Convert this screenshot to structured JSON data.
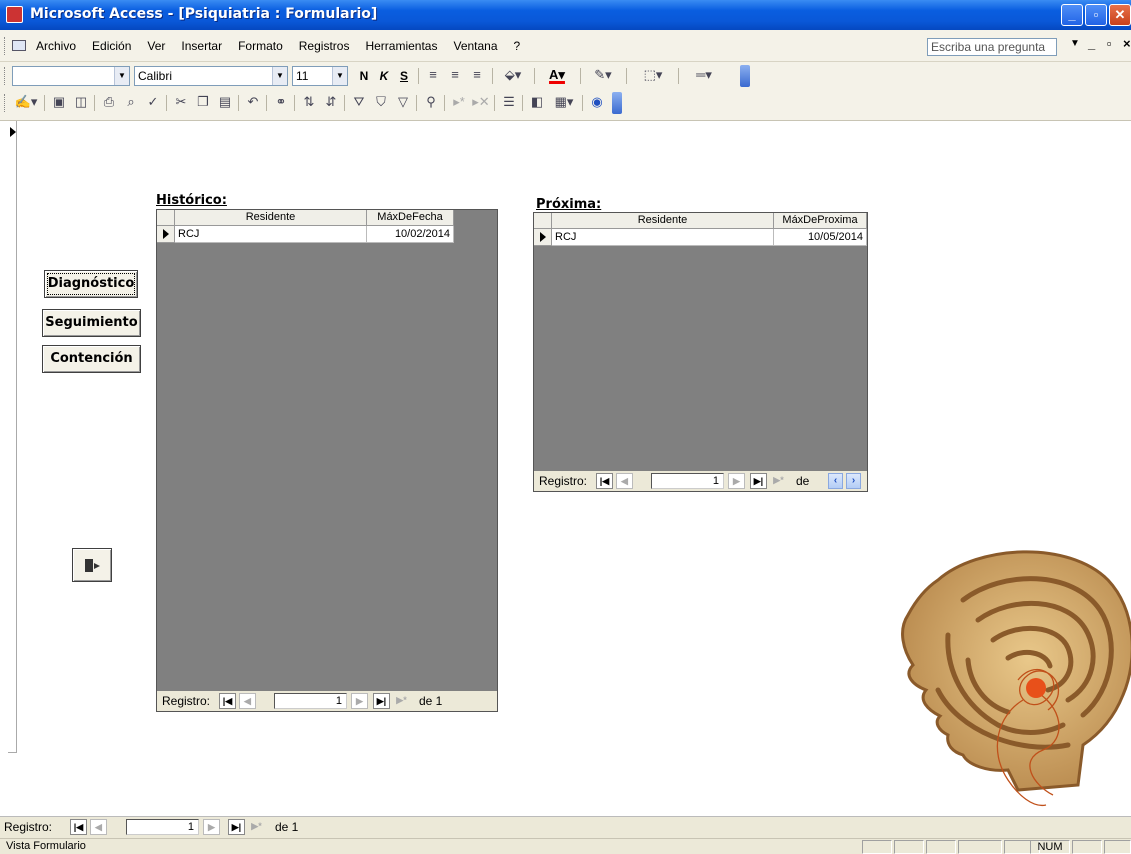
{
  "window": {
    "title": "Microsoft Access - [Psiquiatria : Formulario]",
    "controls": {
      "minimize": "_",
      "maximize": "▫",
      "close": "✕"
    }
  },
  "menubar": {
    "items": [
      "Archivo",
      "Edición",
      "Ver",
      "Insertar",
      "Formato",
      "Registros",
      "Herramientas",
      "Ventana",
      "?"
    ],
    "ask_placeholder": "Escriba una pregunta",
    "mdi_controls": "_ ▫ ×"
  },
  "format_toolbar": {
    "object_combo": "",
    "font_name": "Calibri",
    "font_size": "11",
    "bold": "N",
    "italic": "K",
    "underline": "S"
  },
  "form": {
    "buttons": [
      "Diagnóstico",
      "Seguimiento",
      "Contención"
    ],
    "historico": {
      "label": "Histórico:",
      "columns": [
        "Residente",
        "MáxDeFecha"
      ],
      "rows": [
        [
          "RCJ",
          "10/02/2014"
        ]
      ],
      "nav": {
        "label": "Registro:",
        "current": "1",
        "of_text": "de 1"
      }
    },
    "proxima": {
      "label": "Próxima:",
      "columns": [
        "Residente",
        "MáxDeProxima"
      ],
      "rows": [
        [
          "RCJ",
          "10/05/2014"
        ]
      ],
      "nav": {
        "label": "Registro:",
        "current": "1",
        "of_text": "de"
      }
    }
  },
  "main_nav": {
    "label": "Registro:",
    "current": "1",
    "of_text": "de 1"
  },
  "statusbar": {
    "left_text": "Vista Formulario",
    "num_indicator": "NUM"
  },
  "icons": {
    "exit": "exit-door-icon",
    "nav_first": "first-record-icon",
    "nav_prev": "previous-record-icon",
    "nav_next": "next-record-icon",
    "nav_last": "last-record-icon",
    "nav_new": "new-record-icon"
  },
  "colors": {
    "titlebar": "#0a5ee0",
    "datasheet_bg": "#808080",
    "toolbar_bg": "#f4f2e8"
  }
}
